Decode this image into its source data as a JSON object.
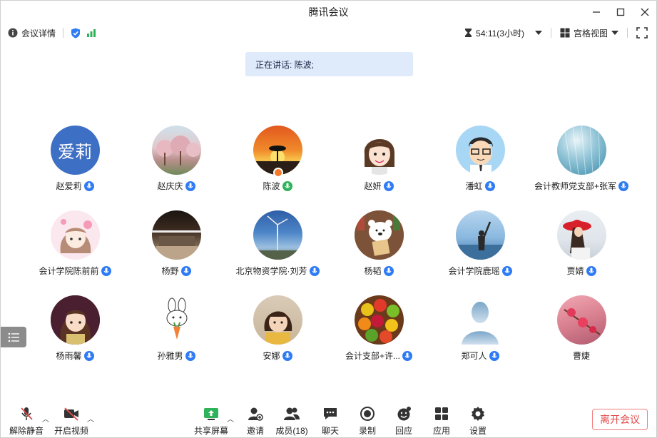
{
  "window": {
    "title": "腾讯会议"
  },
  "infobar": {
    "details_label": "会议详情",
    "timer": "54:11(3小时)",
    "view_label": "宫格视图"
  },
  "speaking": {
    "text": "正在讲话: 陈波;"
  },
  "participants": [
    {
      "name": "赵爱莉",
      "avatar_text": "爱莉",
      "mic": "blue"
    },
    {
      "name": "赵庆庆",
      "avatar_text": "",
      "mic": "blue"
    },
    {
      "name": "陈波",
      "avatar_text": "",
      "mic": "green"
    },
    {
      "name": "赵妍",
      "avatar_text": "",
      "mic": "blue"
    },
    {
      "name": "潘虹",
      "avatar_text": "",
      "mic": "blue"
    },
    {
      "name": "会计教师党支部+张军",
      "avatar_text": "",
      "mic": "blue"
    },
    {
      "name": "会计学院陈前前",
      "avatar_text": "",
      "mic": "blue"
    },
    {
      "name": "杨野",
      "avatar_text": "",
      "mic": "blue"
    },
    {
      "name": "北京物资学院·刘芳",
      "avatar_text": "",
      "mic": "blue"
    },
    {
      "name": "杨韬",
      "avatar_text": "",
      "mic": "blue"
    },
    {
      "name": "会计学院鹿瑶",
      "avatar_text": "",
      "mic": "blue"
    },
    {
      "name": "贾婧",
      "avatar_text": "",
      "mic": "blue"
    },
    {
      "name": "杨雨馨",
      "avatar_text": "",
      "mic": "blue"
    },
    {
      "name": "孙雅男",
      "avatar_text": "",
      "mic": "blue"
    },
    {
      "name": "安娜",
      "avatar_text": "",
      "mic": "blue"
    },
    {
      "name": "会计支部+许...",
      "avatar_text": "",
      "mic": "blue"
    },
    {
      "name": "郑可人",
      "avatar_text": "",
      "mic": "blue"
    },
    {
      "name": "曹婕",
      "avatar_text": "",
      "mic": "none"
    }
  ],
  "toolbar": {
    "unmute": "解除静音",
    "start_video": "开启视频",
    "share_screen": "共享屏幕",
    "invite": "邀请",
    "members": "成员(18)",
    "chat": "聊天",
    "record": "录制",
    "react": "回应",
    "apps": "应用",
    "settings": "设置",
    "leave": "离开会议"
  },
  "colors": {
    "accent": "#2f7bf5",
    "speaking_bg": "#dfeafb",
    "leave": "#e24a4a"
  }
}
